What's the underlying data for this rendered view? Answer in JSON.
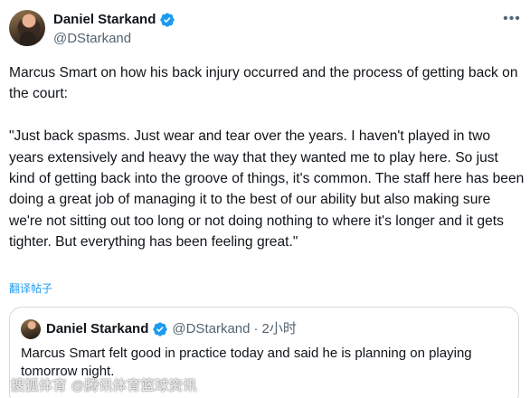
{
  "author": {
    "display_name": "Daniel Starkand",
    "handle": "@DStarkand",
    "verified_icon": "verified-badge-icon"
  },
  "tweet": {
    "text": "Marcus Smart on how his back injury occurred and the process of getting back on the court:\n\n\"Just back spasms. Just wear and tear over the years. I haven't played in two years extensively and heavy the way that they wanted me to play here. So just kind of getting back into the groove of things, it's common. The staff here has been doing a great job of managing it to the best of our ability but also making sure we're not sitting out too long or not doing nothing to where it's longer and it gets tighter. But everything has been feeling great.\"",
    "translate_label": "翻译帖子"
  },
  "quoted_tweet": {
    "display_name": "Daniel Starkand",
    "handle": "@DStarkand",
    "separator": "·",
    "time": "2小时",
    "text": "Marcus Smart felt good in practice today and said he is planning on playing tomorrow night."
  },
  "watermark": "搜狐体育 @腾讯体育篮球资讯",
  "colors": {
    "verified": "#1d9bf0",
    "link": "#1d9bf0",
    "secondary_text": "#536471",
    "border": "#cfd9de"
  }
}
